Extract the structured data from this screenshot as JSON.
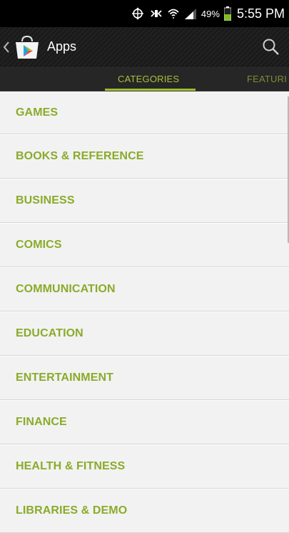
{
  "status_bar": {
    "battery_percent": "49%",
    "time": "5:55 PM",
    "icons": [
      "nfc-icon",
      "vibrate-icon",
      "wifi-icon",
      "signal-icon",
      "battery-icon"
    ]
  },
  "action_bar": {
    "title": "Apps",
    "icons": [
      "back-chevron-icon",
      "play-store-icon",
      "search-icon"
    ]
  },
  "tabs": [
    {
      "label": "CATEGORIES",
      "selected": true
    },
    {
      "label": "FEATURI",
      "selected": false
    }
  ],
  "categories": [
    {
      "label": "GAMES"
    },
    {
      "label": "BOOKS & REFERENCE"
    },
    {
      "label": "BUSINESS"
    },
    {
      "label": "COMICS"
    },
    {
      "label": "COMMUNICATION"
    },
    {
      "label": "EDUCATION"
    },
    {
      "label": "ENTERTAINMENT"
    },
    {
      "label": "FINANCE"
    },
    {
      "label": "HEALTH & FITNESS"
    },
    {
      "label": "LIBRARIES & DEMO"
    }
  ],
  "colors": {
    "accent": "#8aab2a",
    "status_bar": "#000000",
    "action_bar": "#1a1a1a",
    "list_background": "#f2f2f2"
  }
}
